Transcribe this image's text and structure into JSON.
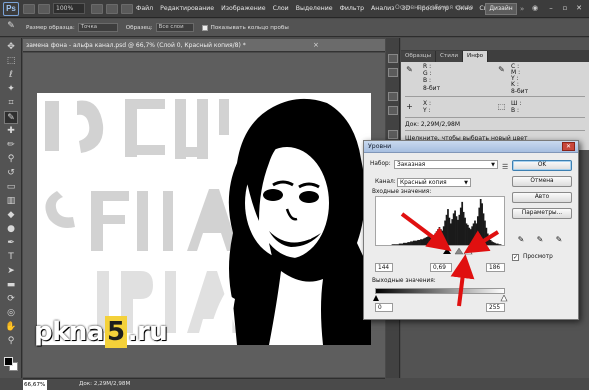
{
  "menubar": {
    "logo": "Ps",
    "zoom": "100%",
    "items": [
      "Файл",
      "Редактирование",
      "Изображение",
      "Слои",
      "Выделение",
      "Фильтр",
      "Анализ",
      "3D",
      "Просмотр",
      "Окно",
      "Справка"
    ],
    "workspace": "Основная рабочая среда",
    "design_button": "Дизайн"
  },
  "options": {
    "sample_size_label": "Размер образца:",
    "sample_size_value": "Точка",
    "sample_label": "Образец:",
    "sample_value": "Все слои",
    "show_ring_label": "Показывать кольцо пробы"
  },
  "document": {
    "tab_title": "замена фона - альфа канал.psd @ 66,7% (Слой 0, Красный копия/8) *",
    "zoom": "66,67%",
    "doc_size": "Док: 2,29M/2,98M"
  },
  "panel": {
    "tabs": [
      "Образцы",
      "Стили",
      "Инфо"
    ],
    "active_tab": "Инфо",
    "info": {
      "r": "R :",
      "g": "G :",
      "b": "B :",
      "c": "C :",
      "m": "M :",
      "y": "Y :",
      "k": "K :",
      "bit_left": "8-бит",
      "bit_right": "8-бит",
      "x": "X :",
      "y_coord": "Y :",
      "w": "Ш :",
      "h": "В :",
      "doc": "Док: 2,29M/2,98M",
      "hint": "Щелкните, чтобы выбрать новый цвет"
    }
  },
  "levels": {
    "title": "Уровни",
    "preset_label": "Набор:",
    "preset_value": "Заказная",
    "channel_label": "Канал:",
    "channel_value": "Красный копия",
    "input_label": "Входные значения:",
    "input_black": "144",
    "input_gamma": "0,69",
    "input_white": "186",
    "output_label": "Выходные значения:",
    "output_black": "0",
    "output_white": "255",
    "buttons": {
      "ok": "OK",
      "cancel": "Отмена",
      "auto": "Авто",
      "params": "Параметры..."
    },
    "preview_label": "Просмотр",
    "histogram": [
      0,
      0,
      0,
      0,
      0,
      0,
      0,
      0,
      0,
      0,
      0,
      1,
      1,
      1,
      1,
      1,
      2,
      2,
      2,
      3,
      3,
      3,
      4,
      4,
      5,
      5,
      6,
      6,
      6,
      7,
      7,
      8,
      8,
      9,
      10,
      11,
      12,
      14,
      13,
      12,
      14,
      16,
      19,
      22,
      25,
      22,
      20,
      26,
      34,
      42,
      50,
      38,
      30,
      36,
      44,
      48,
      40,
      35,
      42,
      52,
      60,
      46,
      38,
      30,
      28,
      24,
      22,
      26,
      30,
      34,
      30,
      40,
      52,
      64,
      58,
      44,
      34,
      24,
      16,
      10,
      7,
      5,
      4,
      3,
      2,
      2,
      1,
      1,
      0,
      0
    ]
  },
  "watermark": {
    "part1": "pkna",
    "part2": "5",
    "part3": ".ru"
  }
}
